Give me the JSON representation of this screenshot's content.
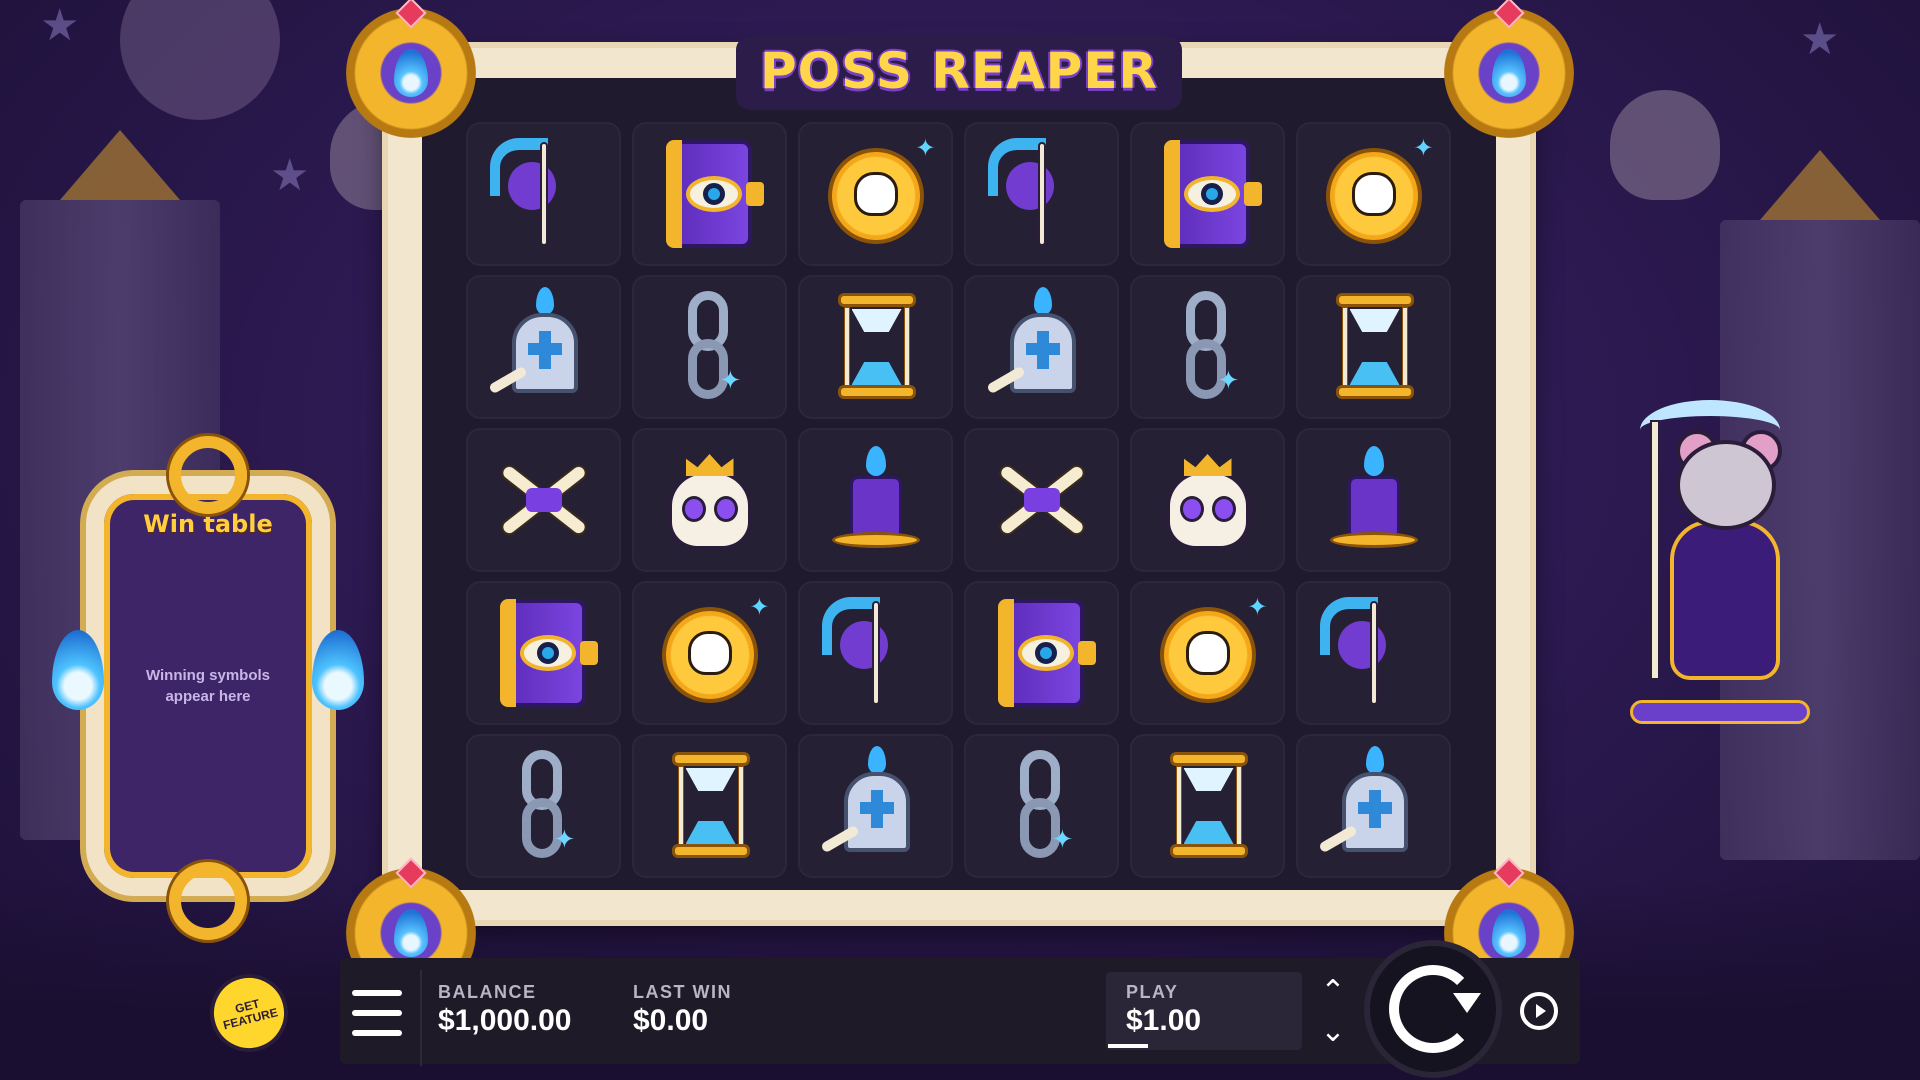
{
  "game": {
    "title": "POSS REAPER"
  },
  "win_table": {
    "title": "Win table",
    "placeholder": "Winning symbols appear here"
  },
  "grid": {
    "columns": 6,
    "rows": [
      [
        "scythe-icon",
        "eye-book-icon",
        "skull-coin-icon",
        "scythe-icon",
        "eye-book-icon",
        "skull-coin-icon"
      ],
      [
        "tombstone-icon",
        "chain-icon",
        "hourglass-icon",
        "tombstone-icon",
        "chain-icon",
        "hourglass-icon"
      ],
      [
        "crossed-bones-icon",
        "crowned-skull-icon",
        "candle-icon",
        "crossed-bones-icon",
        "crowned-skull-icon",
        "candle-icon"
      ],
      [
        "eye-book-icon",
        "skull-coin-icon",
        "scythe-icon",
        "eye-book-icon",
        "skull-coin-icon",
        "scythe-icon"
      ],
      [
        "chain-icon",
        "hourglass-icon",
        "tombstone-icon",
        "chain-icon",
        "hourglass-icon",
        "tombstone-icon"
      ]
    ]
  },
  "bottom_bar": {
    "balance_label": "BALANCE",
    "balance_value": "$1,000.00",
    "last_win_label": "LAST WIN",
    "last_win_value": "$0.00",
    "play_label": "PLAY",
    "play_value": "$1.00",
    "menu_icon": "hamburger-menu-icon",
    "spin_icon": "spin-icon",
    "autoplay_icon": "autoplay-icon"
  },
  "get_feature": {
    "label": "GET FEATURE"
  },
  "colors": {
    "background": "#2d1a52",
    "frame": "#f3e6cf",
    "gold": "#f3b52c",
    "purple": "#7a3fe0",
    "blue_flame": "#3ab4ff",
    "panel_dark": "#1e1a28"
  }
}
